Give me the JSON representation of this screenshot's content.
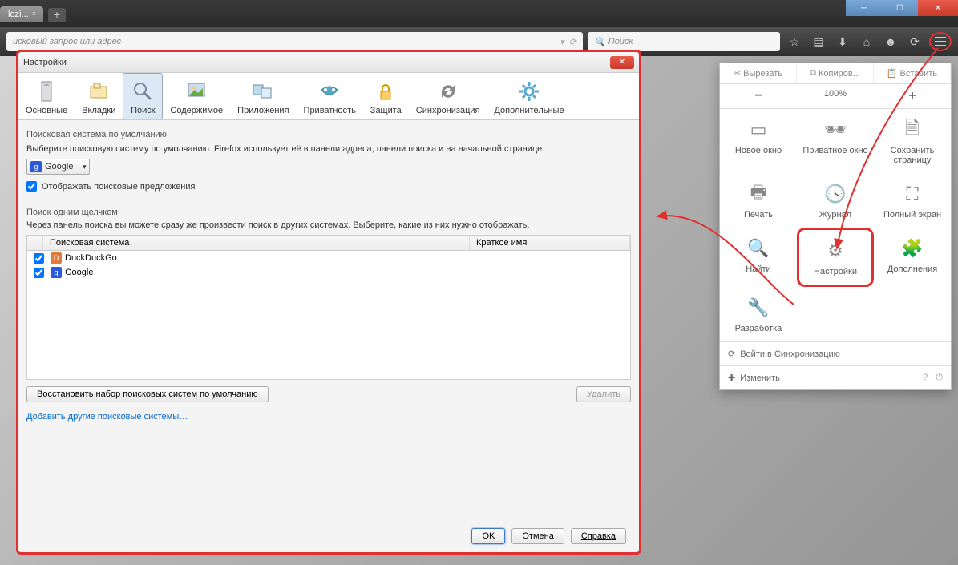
{
  "titlebar": {
    "tab_label": "lozi..."
  },
  "toolbar": {
    "address_placeholder": "исковый запрос или адрес",
    "search_placeholder": "Поиск"
  },
  "dialog": {
    "title": "Настройки",
    "categories": [
      {
        "label": "Основные"
      },
      {
        "label": "Вкладки"
      },
      {
        "label": "Поиск"
      },
      {
        "label": "Содержимое"
      },
      {
        "label": "Приложения"
      },
      {
        "label": "Приватность"
      },
      {
        "label": "Защита"
      },
      {
        "label": "Синхронизация"
      },
      {
        "label": "Дополнительные"
      }
    ],
    "default_search": {
      "title": "Поисковая система по умолчанию",
      "desc": "Выберите поисковую систему по умолчанию. Firefox использует её в панели адреса, панели поиска и на начальной странице.",
      "selected": "Google",
      "show_suggestions": "Отображать поисковые предложения"
    },
    "oneclick": {
      "title": "Поиск одним щелчком",
      "desc": "Через панель поиска вы можете сразу же произвести поиск в других системах. Выберите, какие из них нужно отображать.",
      "col_engine": "Поисковая система",
      "col_keyword": "Краткое имя",
      "engines": [
        {
          "name": "DuckDuckGo",
          "icon_bg": "#e07a3a",
          "icon_txt": "D"
        },
        {
          "name": "Google",
          "icon_bg": "#2a5adb",
          "icon_txt": "g"
        }
      ],
      "restore": "Восстановить набор поисковых систем по умолчанию",
      "delete": "Удалить",
      "add_link": "Добавить другие поисковые системы…"
    },
    "buttons": {
      "ok": "OK",
      "cancel": "Отмена",
      "help": "Справка"
    }
  },
  "menu": {
    "cut": "Вырезать",
    "copy": "Копиров...",
    "paste": "Вставить",
    "zoom_out": "−",
    "zoom_value": "100%",
    "zoom_in": "+",
    "items": [
      {
        "label": "Новое окно"
      },
      {
        "label": "Приватное окно"
      },
      {
        "label": "Сохранить страницу"
      },
      {
        "label": "Печать"
      },
      {
        "label": "Журнал"
      },
      {
        "label": "Полный экран"
      },
      {
        "label": "Найти"
      },
      {
        "label": "Настройки"
      },
      {
        "label": "Дополнения"
      },
      {
        "label": "Разработка"
      }
    ],
    "sync": "Войти в Синхронизацию",
    "customize": "Изменить"
  }
}
